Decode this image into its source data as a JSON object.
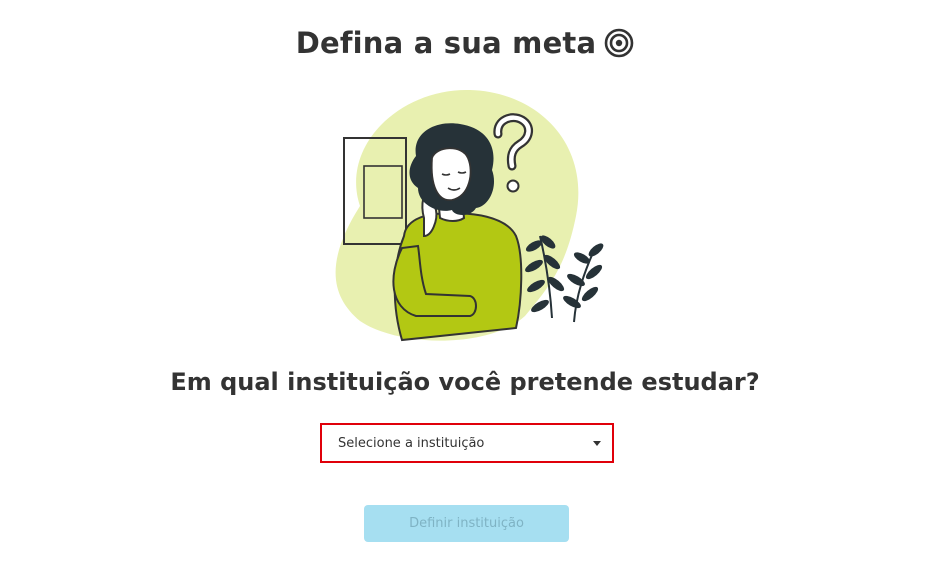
{
  "header": {
    "title": "Defina a sua meta",
    "title_icon": "target-icon"
  },
  "illustration": {
    "subject": "woman-thinking-illustration",
    "accent_color": "#b3c813",
    "blob_color": "#e8f0b0"
  },
  "form": {
    "question": "Em qual instituição você pretende estudar?",
    "select": {
      "placeholder": "Selecione a instituição",
      "highlight_color": "#e0000a"
    },
    "submit": {
      "label": "Definir instituição",
      "disabled": true,
      "color": "#a6dff1"
    }
  }
}
